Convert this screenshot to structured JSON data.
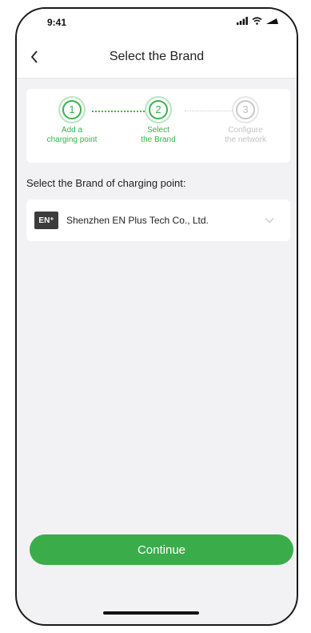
{
  "status_bar": {
    "time": "9:41"
  },
  "nav": {
    "title": "Select the Brand",
    "back_icon": "chevron-left-icon"
  },
  "steps": [
    {
      "number": "1",
      "line1": "Add a",
      "line2": "charging point",
      "state": "done"
    },
    {
      "number": "2",
      "line1": "Select",
      "line2": "the Brand",
      "state": "active"
    },
    {
      "number": "3",
      "line1": "Configure",
      "line2": "the network",
      "state": "pending"
    }
  ],
  "section_label": "Select the Brand of charging point:",
  "brand": {
    "logo_text": "EN⁺",
    "name": "Shenzhen EN Plus Tech Co., Ltd."
  },
  "continue_label": "Continue",
  "colors": {
    "accent": "#3aad4a",
    "background": "#f2f2f4",
    "inactive": "#c4c4c4"
  }
}
